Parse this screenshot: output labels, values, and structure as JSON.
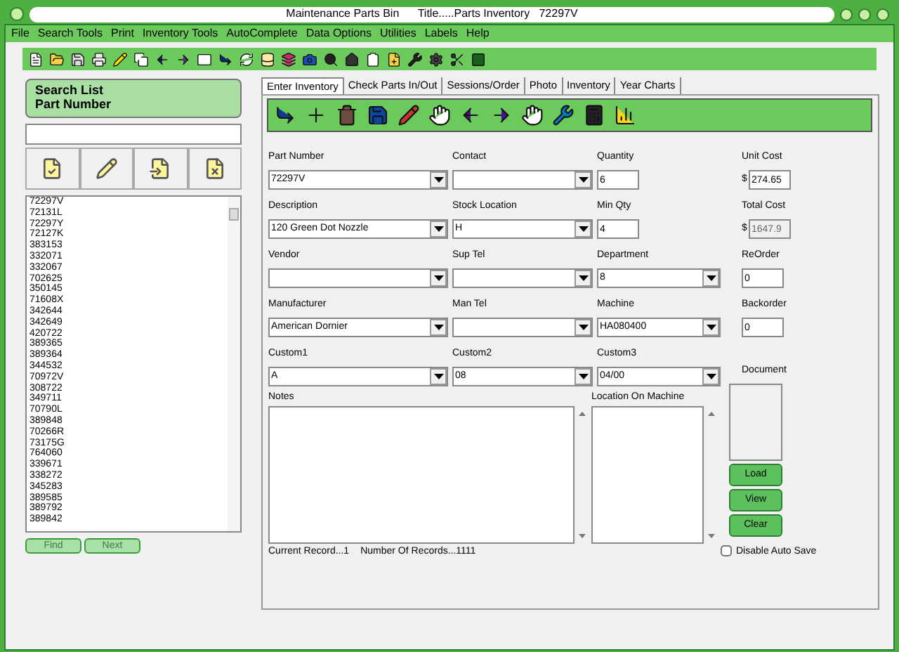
{
  "window": {
    "title": "Maintenance Parts Bin      Title.....Parts Inventory   72297V"
  },
  "menu": [
    {
      "label": "File"
    },
    {
      "label": "Search Tools"
    },
    {
      "label": "Print"
    },
    {
      "label": "Inventory Tools"
    },
    {
      "label": "AutoComplete"
    },
    {
      "label": "Data Options"
    },
    {
      "label": "Utilities"
    },
    {
      "label": "Labels"
    },
    {
      "label": "Help"
    }
  ],
  "search_panel": {
    "title": "Search List",
    "subtitle": "Part Number",
    "list": [
      "72297V",
      "72131L",
      "72297Y",
      "72127K",
      "383153",
      "332071",
      "332067",
      "702625",
      "350145",
      "71608X",
      "342644",
      "342649",
      "420722",
      "389365",
      "389364",
      "344532",
      "70972V",
      "308722",
      "349711",
      "70790L",
      "389848",
      "70266R",
      "73175G",
      "764060",
      "339671",
      "338272",
      "345283",
      "389585",
      "389792",
      "389842"
    ],
    "buttons": [
      {
        "label": "Find",
        "disabled": true
      },
      {
        "label": "Next",
        "disabled": true
      }
    ]
  },
  "tabs": [
    {
      "label": "Enter Inventory",
      "selected": true
    },
    {
      "label": "Check Parts In/Out",
      "selected": false
    },
    {
      "label": "Sessions/Order",
      "selected": false
    },
    {
      "label": "Photo",
      "selected": false
    },
    {
      "label": "Inventory",
      "selected": false
    },
    {
      "label": "Year Charts",
      "selected": false
    }
  ],
  "fields": [
    {
      "label": "Part Number",
      "kind": "combo",
      "value": "72297V"
    },
    {
      "label": "Contact",
      "kind": "combo"
    },
    {
      "label": "Quantity",
      "kind": "short",
      "value": "6"
    },
    {
      "label": "Unit Cost",
      "kind": "money",
      "value": "274.65",
      "prefix": "$",
      "disabled": false
    },
    {
      "label": "Description",
      "kind": "combo",
      "value": "120 Green Dot Nozzle"
    },
    {
      "label": "Stock Location",
      "kind": "combo",
      "value": "H"
    },
    {
      "label": "Min Qty",
      "kind": "short",
      "value": "4"
    },
    {
      "label": "Total Cost",
      "kind": "money",
      "value": "1647.9",
      "prefix": "$",
      "disabled": true
    },
    {
      "label": "Vendor",
      "kind": "combo"
    },
    {
      "label": "Sup Tel",
      "kind": "combo"
    },
    {
      "label": "Department",
      "kind": "combo",
      "value": "8"
    },
    {
      "label": "ReOrder",
      "kind": "money",
      "value": "0",
      "disabled": false
    },
    {
      "label": "Manufacturer",
      "kind": "combo",
      "value": "American Dornier"
    },
    {
      "label": "Man Tel",
      "kind": "combo"
    },
    {
      "label": "Machine",
      "kind": "combo",
      "value": "HA080400"
    },
    {
      "label": "Backorder",
      "kind": "money",
      "value": "0",
      "disabled": false
    },
    {
      "label": "Custom1",
      "kind": "combo",
      "value": "A"
    },
    {
      "label": "Custom2",
      "kind": "combo",
      "value": "08"
    },
    {
      "label": "Custom3",
      "kind": "combo",
      "value": "04/00"
    },
    {
      "label": "Document",
      "kind": "label"
    }
  ],
  "notes": {
    "label": "Notes"
  },
  "location": {
    "label": "Location On Machine"
  },
  "document_buttons": [
    {
      "label": "Load"
    },
    {
      "label": "View"
    },
    {
      "label": "Clear"
    }
  ],
  "disable_auto_save": {
    "label": "Disable Auto Save",
    "checked": false
  },
  "status": {
    "current": "Current Record...1",
    "count": "Number Of Records...1111"
  }
}
